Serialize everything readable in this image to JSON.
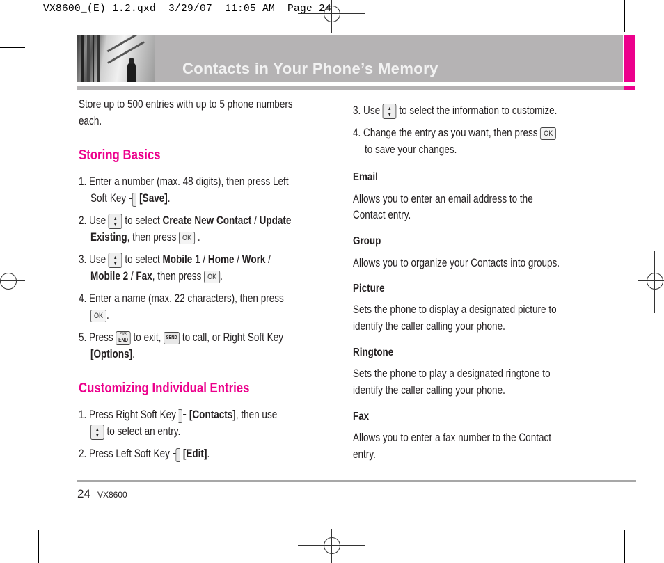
{
  "slug": {
    "text": "VX8600_(E) 1.2.qxd  3/29/07  11:05 AM  Page 24"
  },
  "banner": {
    "title": "Contacts in Your Phone’s Memory",
    "accent_color": "#ec008c",
    "banner_color": "#b5b3b4"
  },
  "left_column": {
    "intro": [
      "Store up to 500 entries with up to 5 phone numbers",
      "each."
    ],
    "storing_basics": {
      "heading": "Storing Basics",
      "steps": {
        "s1": {
          "num": "1.",
          "a": "Enter a number (max. 48 digits), then press Left",
          "b": "Soft Key",
          "bold": "[Save]",
          "end": "."
        },
        "s2": {
          "num": "2.",
          "a": "Use",
          "b": "to select",
          "bold1": "Create New Contact",
          "sep": " / ",
          "bold2": "Update",
          "bold3": "Existing",
          "c": ", then press",
          "end": "."
        },
        "s3": {
          "num": "3.",
          "a": "Use",
          "b": "to select",
          "bold1": "Mobile 1",
          "bold2": "Home",
          "bold3": "Work",
          "bold4": "Mobile 2",
          "bold5": "Fax",
          "sep": " / ",
          "c": ", then press",
          "end": "."
        },
        "s4": {
          "num": "4.",
          "a": "Enter a name (max. 22 characters), then press",
          "end": "."
        },
        "s5": {
          "num": "5.",
          "a": "Press",
          "b": "to exit,",
          "c": "to call, or Right Soft Key",
          "bold": "[Options]",
          "end": "."
        }
      }
    },
    "customizing": {
      "heading": "Customizing Individual Entries",
      "steps": {
        "s1": {
          "num": "1.",
          "a": "Press Right Soft Key",
          "bold": "[Contacts]",
          "b": ", then use",
          "c": "to select an entry."
        },
        "s2": {
          "num": "2.",
          "a": "Press Left Soft Key",
          "bold": "[Edit]",
          "end": "."
        }
      }
    }
  },
  "right_column": {
    "steps": {
      "s3": {
        "num": "3.",
        "a": "Use",
        "b": "to select the information to customize."
      },
      "s4": {
        "num": "4.",
        "a": "Change the entry as you want, then press",
        "b": "to save your changes."
      }
    },
    "fields": [
      {
        "heading": "Email",
        "lines": [
          "Allows you to enter an email address to the",
          "Contact entry."
        ]
      },
      {
        "heading": "Group",
        "lines": [
          "Allows you to organize your Contacts into groups."
        ]
      },
      {
        "heading": "Picture",
        "lines": [
          "Sets the phone to display a designated picture to",
          "identify the caller calling your phone."
        ]
      },
      {
        "heading": "Ringtone",
        "lines": [
          "Sets the phone to play a designated ringtone to",
          "identify the caller calling your phone."
        ]
      },
      {
        "heading": "Fax",
        "lines": [
          "Allows you to enter a fax number to the Contact",
          "entry."
        ]
      }
    ]
  },
  "keys": {
    "ok": "OK",
    "pwr": "PWR",
    "end": "END",
    "send": "SEND",
    "up": "▲",
    "down": "▼"
  },
  "footer": {
    "page_number": "24",
    "model": "VX8600"
  },
  "icons": {
    "nav_key": "nav-key-icon",
    "ok_key": "ok-key-icon",
    "end_key": "end-key-icon",
    "send_key": "send-key-icon",
    "left_soft_key": "left-soft-key-icon",
    "right_soft_key": "right-soft-key-icon"
  }
}
